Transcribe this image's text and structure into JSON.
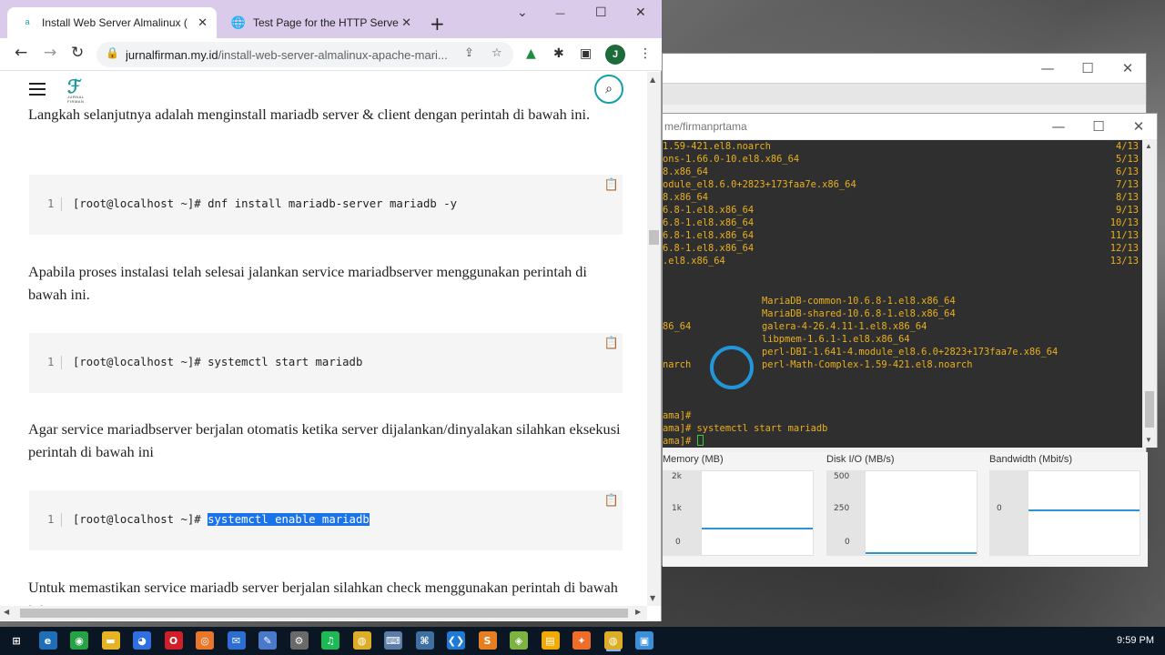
{
  "browser": {
    "tabs": [
      {
        "title": "Install Web Server Almalinux (Ap",
        "active": true
      },
      {
        "title": "Test Page for the HTTP Server on",
        "active": false
      }
    ],
    "new_tab": "+",
    "minimize": "⌄",
    "restore": "☐",
    "close": "✕",
    "url_domain": "jurnalfirman.my.id",
    "url_path": "/install-web-server-almalinux-apache-mari...",
    "avatar_letter": "J"
  },
  "page": {
    "logo_text": "JURNAL FIRMAN",
    "para1": "Langkah selanjutnya adalah menginstall mariadb server & client dengan perintah di bawah ini.",
    "code1": {
      "line": "1",
      "prompt": "[root@localhost ~]# ",
      "cmd": "dnf install mariadb-server mariadb -y"
    },
    "para2": "Apabila proses instalasi telah selesai jalankan service mariadbserver menggunakan perintah di bawah ini.",
    "code2": {
      "line": "1",
      "prompt": "[root@localhost ~]# ",
      "cmd": "systemctl start mariadb"
    },
    "para3": "Agar service mariadbserver berjalan otomatis ketika server dijalankan/dinyalakan silahkan eksekusi perintah di bawah ini",
    "code3": {
      "line": "1",
      "prompt": "[root@localhost ~]# ",
      "cmd": "systemctl enable mariadb"
    },
    "para4": "Untuk memastikan service mariadb server berjalan silahkan check menggunakan perintah di bawah ini."
  },
  "terminal": {
    "title": "me/firmanprtama",
    "progress_lines": [
      {
        "text": "1.59-421.el8.noarch",
        "count": "4/13"
      },
      {
        "text": "ons-1.66.0-10.el8.x86_64",
        "count": "5/13"
      },
      {
        "text": "8.x86_64",
        "count": "6/13"
      },
      {
        "text": "odule_el8.6.0+2823+173faa7e.x86_64",
        "count": "7/13"
      },
      {
        "text": "8.x86_64",
        "count": "8/13"
      },
      {
        "text": "6.8-1.el8.x86_64",
        "count": "9/13"
      },
      {
        "text": "6.8-1.el8.x86_64",
        "count": "10/13"
      },
      {
        "text": "6.8-1.el8.x86_64",
        "count": "11/13"
      },
      {
        "text": "6.8-1.el8.x86_64",
        "count": "12/13"
      },
      {
        "text": ".el8.x86_64",
        "count": "13/13"
      }
    ],
    "installed_left": [
      "",
      "",
      "86_64",
      "",
      "",
      "narch"
    ],
    "installed_right": [
      "MariaDB-common-10.6.8-1.el8.x86_64",
      "MariaDB-shared-10.6.8-1.el8.x86_64",
      "galera-4-26.4.11-1.el8.x86_64",
      "libpmem-1.6.1-1.el8.x86_64",
      "perl-DBI-1.641-4.module_el8.6.0+2823+173faa7e.x86_64",
      "perl-Math-Complex-1.59-421.el8.noarch"
    ],
    "prompt_lines": [
      "ama]#",
      "ama]# systemctl start mariadb",
      "ama]# "
    ]
  },
  "task_manager": {
    "graphs": [
      {
        "label": "Memory (MB)",
        "ticks": [
          "2k",
          "1k",
          "0"
        ],
        "level": 0.3
      },
      {
        "label": "Disk I/O (MB/s)",
        "ticks": [
          "500",
          "250",
          "0"
        ],
        "level": 0.0
      },
      {
        "label": "Bandwidth (Mbit/s)",
        "ticks": [
          "0"
        ],
        "level": 0.0
      }
    ]
  },
  "taskbar": {
    "clock": "9:59 PM",
    "apps": [
      "start",
      "edge-legacy",
      "whatsapp",
      "explorer",
      "browser",
      "opera",
      "firefox",
      "mail",
      "paint",
      "settings",
      "spotify",
      "chrome",
      "keyboard",
      "network",
      "vscode",
      "sublime",
      "android",
      "notes",
      "postman",
      "chrome-active",
      "photos"
    ]
  },
  "colors": {
    "terminal_text": "#e8b021",
    "terminal_bg": "#2f2f2f",
    "selection": "#1a73e8",
    "tabstrip": "#d9cbe9",
    "accent_teal": "#15a0a8"
  }
}
